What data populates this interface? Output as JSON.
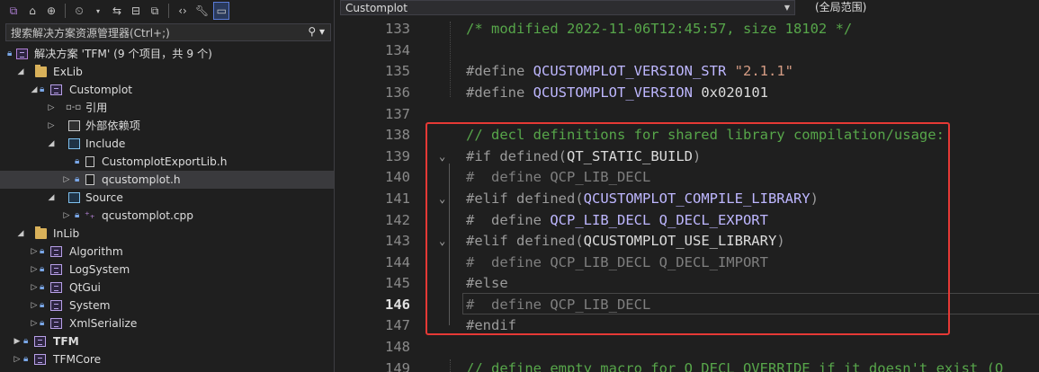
{
  "explorer": {
    "search_placeholder": "搜索解决方案资源管理器(Ctrl+;)",
    "tree": [
      {
        "label": "解决方案 'TFM' (9 个项目，共 9 个)"
      },
      {
        "label": "ExLib"
      },
      {
        "label": "Customplot"
      },
      {
        "label": "引用"
      },
      {
        "label": "外部依赖项"
      },
      {
        "label": "Include"
      },
      {
        "label": "CustomplotExportLib.h"
      },
      {
        "label": "qcustomplot.h"
      },
      {
        "label": "Source"
      },
      {
        "label": "qcustomplot.cpp"
      },
      {
        "label": "InLib"
      },
      {
        "label": "Algorithm"
      },
      {
        "label": "LogSystem"
      },
      {
        "label": "QtGui"
      },
      {
        "label": "System"
      },
      {
        "label": "XmlSerialize"
      },
      {
        "label": "TFM"
      },
      {
        "label": "TFMCore"
      }
    ]
  },
  "editor": {
    "nav_project": "Customplot",
    "nav_scope": "(全局范围)",
    "line_numbers": [
      "133",
      "134",
      "135",
      "136",
      "137",
      "138",
      "139",
      "140",
      "141",
      "142",
      "143",
      "144",
      "145",
      "146",
      "147",
      "148",
      "149"
    ],
    "lines": {
      "l133": "/* modified 2022-11-06T12:45:57, size 18102 */",
      "l135_dir": "#define",
      "l135_mac": "QCUSTOMPLOT_VERSION_STR",
      "l135_str": "\"2.1.1\"",
      "l136_dir": "#define",
      "l136_mac": "QCUSTOMPLOT_VERSION",
      "l136_num": "0x020101",
      "l138": "// decl definitions for shared library compilation/usage:",
      "l139_dir": "#if",
      "l139_kw": "defined(",
      "l139_mac": "QT_STATIC_BUILD",
      "l139_end": ")",
      "l140": "#  define QCP_LIB_DECL",
      "l141_dir": "#elif",
      "l141_kw": "defined(",
      "l141_mac": "QCUSTOMPLOT_COMPILE_LIBRARY",
      "l141_end": ")",
      "l142_dir": "#  define",
      "l142_mac": "QCP_LIB_DECL Q_DECL_EXPORT",
      "l143_dir": "#elif",
      "l143_kw": "defined(",
      "l143_mac": "QCUSTOMPLOT_USE_LIBRARY",
      "l143_end": ")",
      "l144": "#  define QCP_LIB_DECL Q_DECL_IMPORT",
      "l145": "#else",
      "l146": "#  define QCP_LIB_DECL",
      "l147": "#endif",
      "l149": "// define empty macro for Q_DECL_OVERRIDE if it doesn't exist (Q"
    }
  },
  "colors": {
    "comment": "#57a64a",
    "macro": "#beb7ff",
    "string": "#d69d85",
    "highlight_box": "#e53935"
  }
}
